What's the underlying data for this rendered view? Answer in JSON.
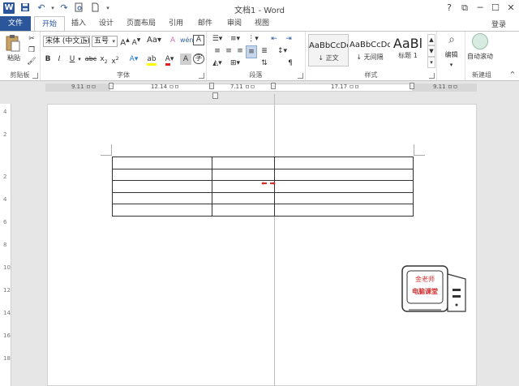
{
  "app": {
    "title": "文档1 - Word"
  },
  "window_controls": {
    "help": "?",
    "ribbon_options": "⧉",
    "minimize": "─",
    "maximize": "☐",
    "close": "✕"
  },
  "tabs": [
    {
      "label": "文件"
    },
    {
      "label": "开始"
    },
    {
      "label": "插入"
    },
    {
      "label": "设计"
    },
    {
      "label": "页面布局"
    },
    {
      "label": "引用"
    },
    {
      "label": "邮件"
    },
    {
      "label": "审阅"
    },
    {
      "label": "视图"
    }
  ],
  "account": {
    "login_label": "登录"
  },
  "ribbon": {
    "clipboard": {
      "paste_label": "粘贴",
      "group_label": "剪贴板"
    },
    "font": {
      "font_name": "宋体 (中文正)",
      "font_size": "五号",
      "group_label": "字体"
    },
    "paragraph": {
      "group_label": "段落"
    },
    "styles": {
      "group_label": "样式",
      "items": [
        {
          "preview": "AaBbCcDd",
          "name": "↓ 正文"
        },
        {
          "preview": "AaBbCcDd",
          "name": "↓ 无间隔"
        },
        {
          "preview": "AaBl",
          "name": "标题 1"
        }
      ]
    },
    "editing": {
      "label": "编辑"
    },
    "new_group": {
      "button_label": "自动滚动",
      "group_label": "新建组"
    }
  },
  "ruler": {
    "labels": [
      "9.11 ㅁㅁ",
      "12.14 ㅁㅁ",
      "7.11 ㅁㅁ",
      "17.17 ㅁㅁ",
      "9.11 ㅁㅁ"
    ],
    "vertical_ticks": [
      "4",
      "2",
      "2",
      "4",
      "6",
      "8",
      "10",
      "12",
      "14",
      "16",
      "18"
    ]
  },
  "document": {
    "table": {
      "rows": 5,
      "cols": 3
    }
  },
  "sticker": {
    "line1": "金老师",
    "line2": "电脑课堂"
  }
}
